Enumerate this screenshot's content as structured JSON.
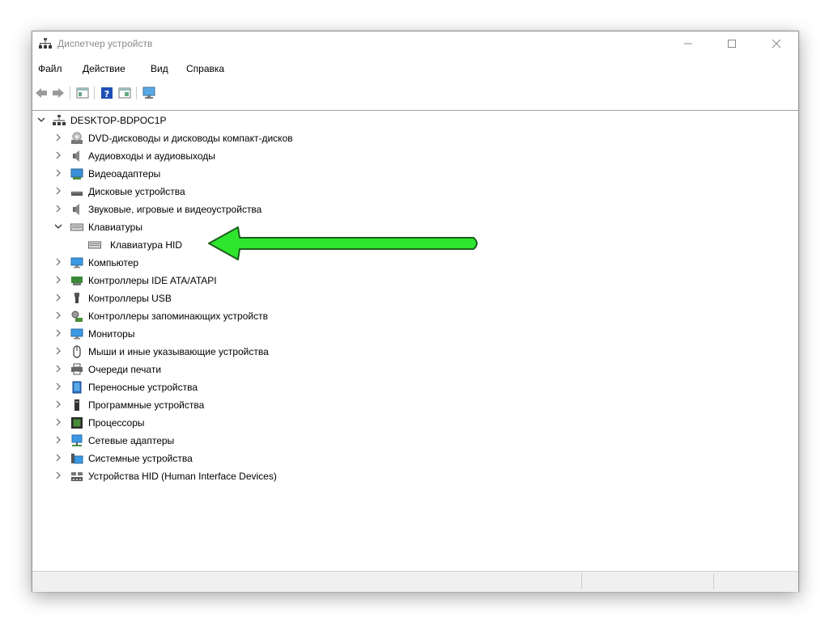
{
  "window": {
    "title": "Диспетчер устройств"
  },
  "menu": [
    "Файл",
    "Действие",
    "Вид",
    "Справка"
  ],
  "toolbar": [
    {
      "name": "back-icon"
    },
    {
      "name": "forward-icon"
    },
    {
      "name": "properties-icon"
    },
    {
      "name": "help-icon"
    },
    {
      "name": "update-driver-icon"
    },
    {
      "name": "scan-hardware-icon"
    }
  ],
  "tree": {
    "root": {
      "label": "DESKTOP-BDPOC1P",
      "icon": "computer-network-icon"
    },
    "categories": [
      {
        "label": "DVD-дисководы и дисководы компакт-дисков",
        "icon": "dvd-drive-icon",
        "expanded": false
      },
      {
        "label": "Аудиовходы и аудиовыходы",
        "icon": "speaker-icon",
        "expanded": false
      },
      {
        "label": "Видеоадаптеры",
        "icon": "display-adapter-icon",
        "expanded": false
      },
      {
        "label": "Дисковые устройства",
        "icon": "disk-drive-icon",
        "expanded": false
      },
      {
        "label": "Звуковые, игровые и видеоустройства",
        "icon": "sound-icon",
        "expanded": false
      },
      {
        "label": "Клавиатуры",
        "icon": "keyboard-icon",
        "expanded": true,
        "children": [
          {
            "label": "Клавиатура HID",
            "icon": "keyboard-icon"
          }
        ]
      },
      {
        "label": "Компьютер",
        "icon": "monitor-icon",
        "expanded": false
      },
      {
        "label": "Контроллеры IDE ATA/ATAPI",
        "icon": "ide-controller-icon",
        "expanded": false
      },
      {
        "label": "Контроллеры USB",
        "icon": "usb-icon",
        "expanded": false
      },
      {
        "label": "Контроллеры запоминающих устройств",
        "icon": "storage-controller-icon",
        "expanded": false
      },
      {
        "label": "Мониторы",
        "icon": "monitor-icon",
        "expanded": false
      },
      {
        "label": "Мыши и иные указывающие устройства",
        "icon": "mouse-icon",
        "expanded": false
      },
      {
        "label": "Очереди печати",
        "icon": "printer-icon",
        "expanded": false
      },
      {
        "label": "Переносные устройства",
        "icon": "portable-device-icon",
        "expanded": false
      },
      {
        "label": "Программные устройства",
        "icon": "software-device-icon",
        "expanded": false
      },
      {
        "label": "Процессоры",
        "icon": "processor-icon",
        "expanded": false
      },
      {
        "label": "Сетевые адаптеры",
        "icon": "network-adapter-icon",
        "expanded": false
      },
      {
        "label": "Системные устройства",
        "icon": "system-device-icon",
        "expanded": false
      },
      {
        "label": "Устройства HID (Human Interface Devices)",
        "icon": "hid-device-icon",
        "expanded": false
      }
    ]
  },
  "colors": {
    "arrow": "#2ee62e",
    "arrow_outline": "#1b5e1b",
    "accent": "#1e73d2"
  }
}
